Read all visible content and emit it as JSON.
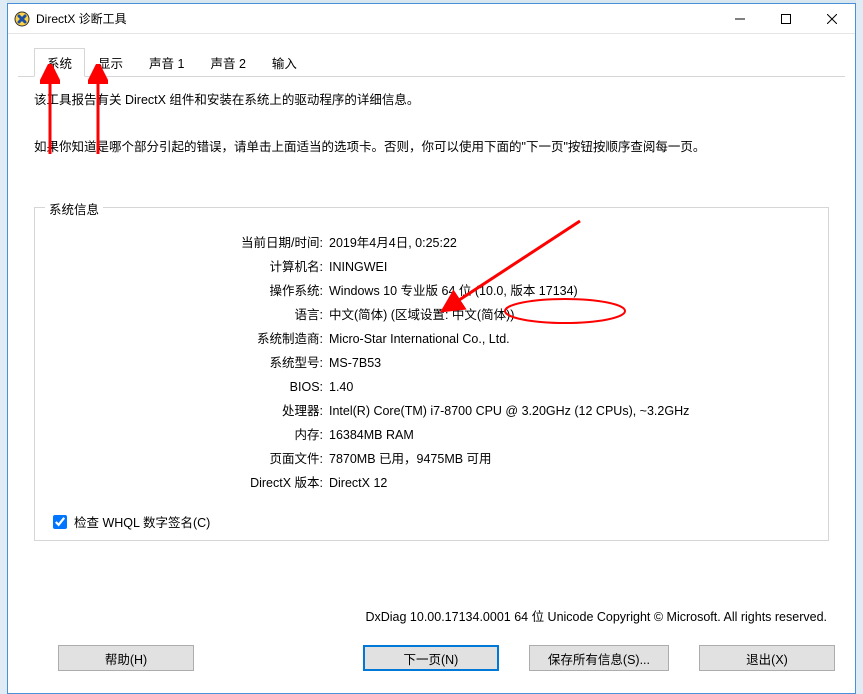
{
  "window": {
    "title": "DirectX 诊断工具"
  },
  "tabs": {
    "system": "系统",
    "display": "显示",
    "sound1": "声音 1",
    "sound2": "声音 2",
    "input": "输入"
  },
  "intro": {
    "line1": "该工具报告有关 DirectX 组件和安装在系统上的驱动程序的详细信息。",
    "line2": "如果你知道是哪个部分引起的错误，请单击上面适当的选项卡。否则，你可以使用下面的\"下一页\"按钮按顺序查阅每一页。"
  },
  "group": {
    "legend": "系统信息"
  },
  "labels": {
    "datetime": "当前日期/时间:",
    "computer": "计算机名:",
    "os": "操作系统:",
    "language": "语言:",
    "manufacturer": "系统制造商:",
    "model": "系统型号:",
    "bios": "BIOS:",
    "processor": "处理器:",
    "memory": "内存:",
    "pagefile": "页面文件:",
    "dxver": "DirectX 版本:"
  },
  "values": {
    "datetime": "2019年4月4日, 0:25:22",
    "computer": "ININGWEI",
    "os": "Windows 10 专业版 64 位 (10.0, 版本 17134)",
    "language": "中文(简体) (区域设置: 中文(简体))",
    "manufacturer": "Micro-Star International Co., Ltd.",
    "model": "MS-7B53",
    "bios": "1.40",
    "processor": "Intel(R) Core(TM) i7-8700 CPU @ 3.20GHz (12 CPUs), ~3.2GHz",
    "memory": "16384MB RAM",
    "pagefile": "7870MB 已用，9475MB 可用",
    "dxver": "DirectX 12"
  },
  "checkbox": {
    "whql": "检查 WHQL 数字签名(C)"
  },
  "copyright": "DxDiag 10.00.17134.0001 64 位 Unicode  Copyright © Microsoft. All rights reserved.",
  "buttons": {
    "help": "帮助(H)",
    "next": "下一页(N)",
    "save": "保存所有信息(S)...",
    "exit": "退出(X)"
  },
  "annotation_colors": {
    "arrow": "#ff0000",
    "circle": "#ff0000"
  }
}
